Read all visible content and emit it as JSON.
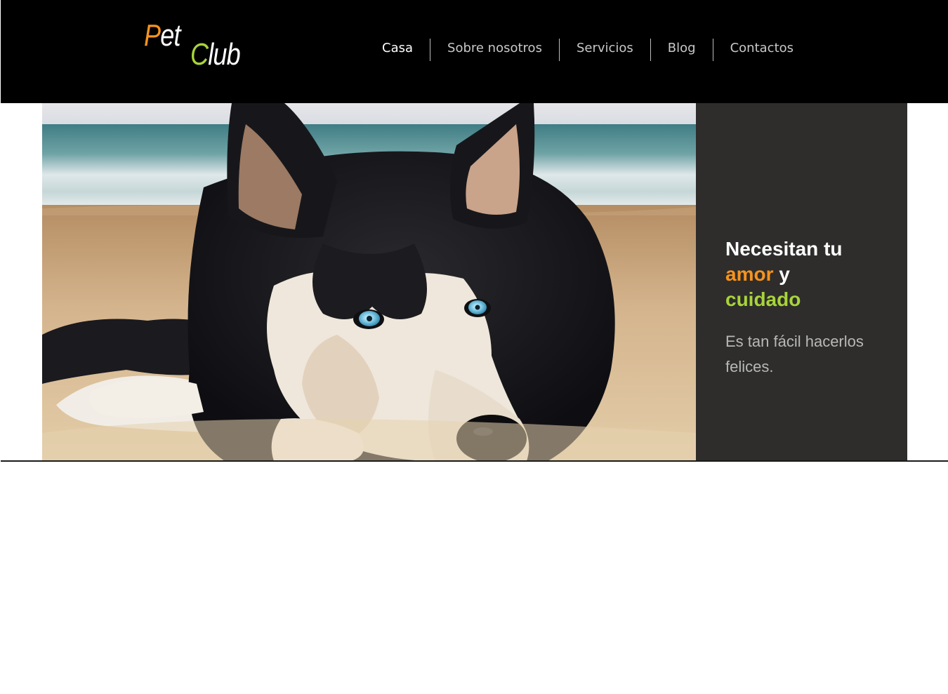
{
  "header": {
    "logo": {
      "word1_initial": "P",
      "word1_rest": "et",
      "word2_initial": "C",
      "word2_rest": "lub"
    },
    "nav": [
      {
        "label": "Casa",
        "active": true
      },
      {
        "label": "Sobre nosotros",
        "active": false
      },
      {
        "label": "Servicios",
        "active": false
      },
      {
        "label": "Blog",
        "active": false
      },
      {
        "label": "Contactos",
        "active": false
      }
    ]
  },
  "hero": {
    "image": "husky-dog-on-beach",
    "headline": {
      "part1": "Necesitan tu",
      "highlight_orange": "amor",
      "part2": "y",
      "highlight_green": "cuidado"
    },
    "subtext": "Es tan fácil hacerlos felices."
  },
  "colors": {
    "header_bg": "#000000",
    "panel_bg": "#2e2d2b",
    "accent_orange": "#f7931e",
    "accent_green": "#a8d43a",
    "nav_text": "#c8c8c8",
    "nav_active": "#ffffff"
  }
}
